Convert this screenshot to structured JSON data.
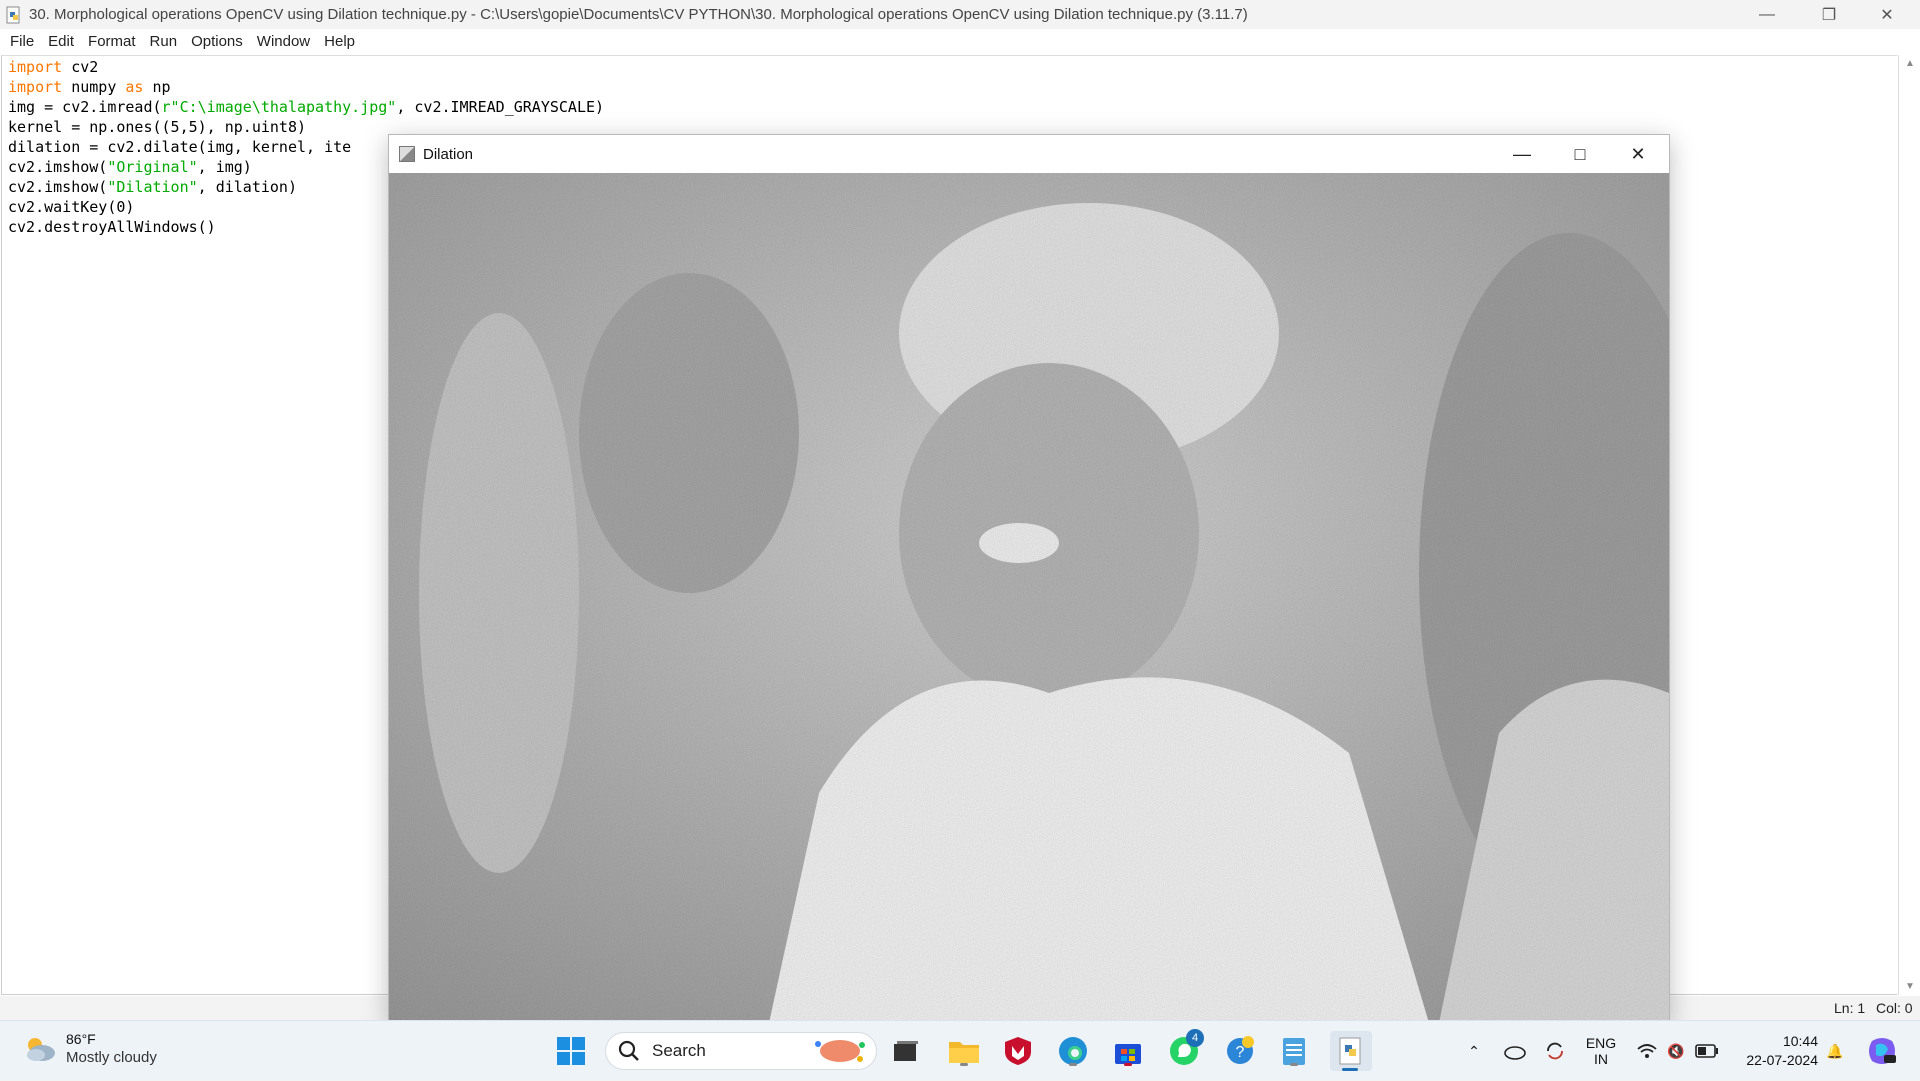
{
  "idle": {
    "title": "30. Morphological operations OpenCV using Dilation technique.py - C:\\Users\\gopie\\Documents\\CV PYTHON\\30. Morphological operations OpenCV using Dilation technique.py (3.11.7)",
    "menu": [
      "File",
      "Edit",
      "Format",
      "Run",
      "Options",
      "Window",
      "Help"
    ],
    "status": {
      "line": "Ln: 1",
      "col": "Col: 0"
    }
  },
  "code_lines": [
    [
      {
        "t": "import",
        "c": "kw"
      },
      {
        "t": " cv2"
      }
    ],
    [
      {
        "t": "import",
        "c": "kw"
      },
      {
        "t": " numpy "
      },
      {
        "t": "as",
        "c": "kw"
      },
      {
        "t": " np"
      }
    ],
    [
      {
        "t": "img = cv2.imread("
      },
      {
        "t": "r\"C:\\image\\thalapathy.jpg\"",
        "c": "str"
      },
      {
        "t": ", cv2.IMREAD_GRAYSCALE)"
      }
    ],
    [
      {
        "t": "kernel = np.ones((5,5), np.uint8)"
      }
    ],
    [
      {
        "t": "dilation = cv2.dilate(img, kernel, ite"
      }
    ],
    [
      {
        "t": "cv2.imshow("
      },
      {
        "t": "\"Original\"",
        "c": "str"
      },
      {
        "t": ", img)"
      }
    ],
    [
      {
        "t": "cv2.imshow("
      },
      {
        "t": "\"Dilation\"",
        "c": "str"
      },
      {
        "t": ", dilation)"
      }
    ],
    [
      {
        "t": "cv2.waitKey(0)"
      }
    ],
    [
      {
        "t": "cv2.destroyAllWindows()"
      }
    ]
  ],
  "dilation_window": {
    "title": "Dilation"
  },
  "taskbar": {
    "weather": {
      "temp": "86°F",
      "condition": "Mostly cloudy"
    },
    "search_label": "Search",
    "whatsapp_badge": "4",
    "language": {
      "lang": "ENG",
      "region": "IN"
    },
    "clock": {
      "time": "10:44",
      "date": "22-07-2024"
    }
  },
  "colors": {
    "keyword": "#ff7700",
    "string": "#00aa00",
    "taskbar_bg": "#eef3f8"
  }
}
